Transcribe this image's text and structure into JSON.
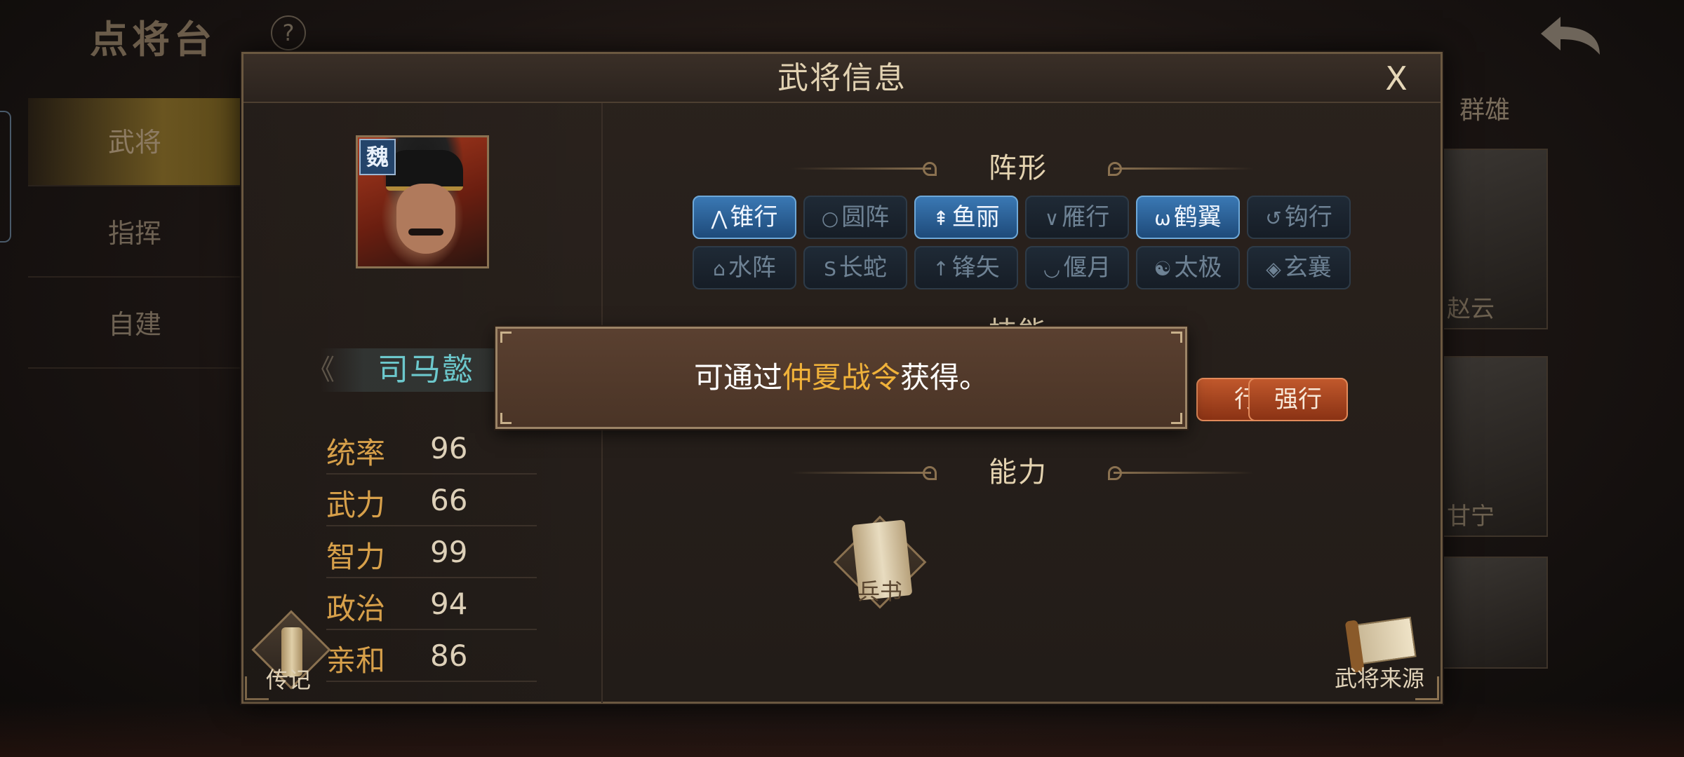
{
  "background": {
    "screen_title": "点将台",
    "help_label": "?",
    "sidebar": [
      {
        "label": "武将",
        "active": true
      },
      {
        "label": "指挥",
        "active": false
      },
      {
        "label": "自建",
        "active": false
      }
    ],
    "faction_filter": "群雄",
    "cards": [
      {
        "name": "赵云"
      },
      {
        "name": "甘宁"
      },
      {
        "name": ""
      }
    ]
  },
  "dialog": {
    "title": "武将信息",
    "close_label": "X",
    "hero": {
      "faction": "魏",
      "name": "司马懿",
      "stats": [
        {
          "label": "统率",
          "value": "96"
        },
        {
          "label": "武力",
          "value": "66"
        },
        {
          "label": "智力",
          "value": "99"
        },
        {
          "label": "政治",
          "value": "94"
        },
        {
          "label": "亲和",
          "value": "86"
        }
      ]
    },
    "biography_label": "传记",
    "source_label": "武将来源",
    "sections": {
      "formation": "阵形",
      "skill": "技能",
      "ability": "能力"
    },
    "formations": [
      {
        "label": "锥行",
        "icon": "⋀",
        "active": true
      },
      {
        "label": "圆阵",
        "icon": "○",
        "active": false
      },
      {
        "label": "鱼丽",
        "icon": "⇞",
        "active": true
      },
      {
        "label": "雁行",
        "icon": "∨",
        "active": false
      },
      {
        "label": "鹤翼",
        "icon": "ω",
        "active": true
      },
      {
        "label": "钩行",
        "icon": "↺",
        "active": false
      },
      {
        "label": "水阵",
        "icon": "⌂",
        "active": false
      },
      {
        "label": "长蛇",
        "icon": "S",
        "active": false
      },
      {
        "label": "锋矢",
        "icon": "↑",
        "active": false
      },
      {
        "label": "偃月",
        "icon": "◡",
        "active": false
      },
      {
        "label": "太极",
        "icon": "☯",
        "active": false
      },
      {
        "label": "玄襄",
        "icon": "◈",
        "active": false
      }
    ],
    "skills": [
      {
        "label": "行"
      },
      {
        "label": "强行"
      }
    ],
    "ability_item": "兵书",
    "toast": {
      "prefix": "可通过",
      "highlight": "仲夏战令",
      "suffix": "获得。"
    }
  },
  "colors": {
    "accent_gold": "#d7a04a",
    "hero_name": "#6cc8cc",
    "formation_active": "#3a78b4",
    "skill_orange": "#c0582c",
    "toast_highlight": "#f0b23a"
  }
}
